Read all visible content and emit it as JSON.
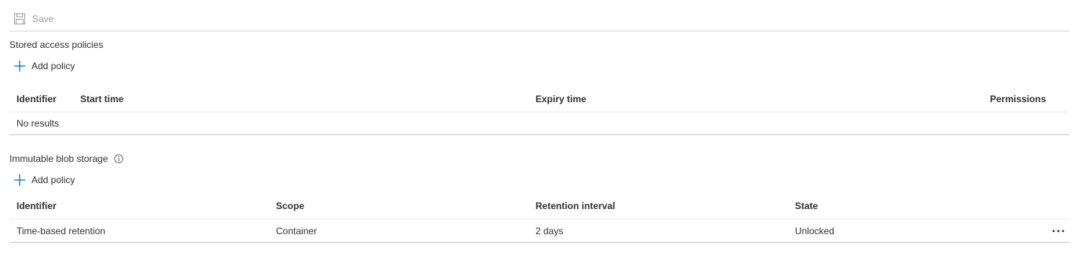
{
  "toolbar": {
    "save_label": "Save"
  },
  "stored_access_policies": {
    "title": "Stored access policies",
    "add_label": "Add policy",
    "columns": {
      "identifier": "Identifier",
      "start_time": "Start time",
      "expiry_time": "Expiry time",
      "permissions": "Permissions"
    },
    "empty_text": "No results"
  },
  "immutable_blob_storage": {
    "title": "Immutable blob storage",
    "add_label": "Add policy",
    "columns": {
      "identifier": "Identifier",
      "scope": "Scope",
      "retention_interval": "Retention interval",
      "state": "State"
    },
    "rows": [
      {
        "identifier": "Time-based retention",
        "scope": "Container",
        "retention_interval": "2 days",
        "state": "Unlocked"
      }
    ]
  },
  "colors": {
    "accent": "#0078d4",
    "disabled_text": "#a19f9d",
    "text": "#323130"
  }
}
